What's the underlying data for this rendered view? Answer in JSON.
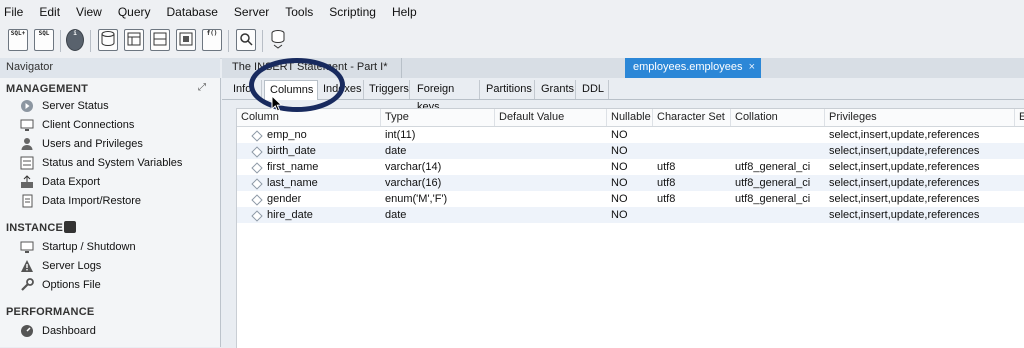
{
  "menu": [
    "File",
    "Edit",
    "View",
    "Query",
    "Database",
    "Server",
    "Tools",
    "Scripting",
    "Help"
  ],
  "toolbar_icons": [
    {
      "name": "new-sql-tab-icon",
      "label": "SQL+"
    },
    {
      "name": "open-sql-script-icon",
      "label": "SQL"
    },
    {
      "name": "inspect-object-icon",
      "label": "i"
    },
    {
      "name": "create-schema-icon",
      "label": ""
    },
    {
      "name": "create-table-icon",
      "label": ""
    },
    {
      "name": "create-view-icon",
      "label": ""
    },
    {
      "name": "create-procedure-icon",
      "label": ""
    },
    {
      "name": "create-function-icon",
      "label": "f()"
    },
    {
      "name": "search-table-data-icon",
      "label": ""
    },
    {
      "name": "reconnect-icon",
      "label": ""
    }
  ],
  "navigator": {
    "title": "Navigator",
    "management": {
      "title": "MANAGEMENT",
      "items": [
        "Server Status",
        "Client Connections",
        "Users and Privileges",
        "Status and System Variables",
        "Data Export",
        "Data Import/Restore"
      ]
    },
    "instance": {
      "title": "INSTANCE",
      "items": [
        "Startup / Shutdown",
        "Server Logs",
        "Options File"
      ]
    },
    "performance": {
      "title": "PERFORMANCE",
      "items": [
        "Dashboard"
      ]
    }
  },
  "editor_tabs": [
    {
      "label": "The INSERT Statement - Part I*"
    },
    {
      "label": "employees.employees",
      "close": "×"
    }
  ],
  "inspector_tabs": [
    "Info",
    "Columns",
    "Indexes",
    "Triggers",
    "Foreign keys",
    "Partitions",
    "Grants",
    "DDL"
  ],
  "columns_table": {
    "headers": [
      "Column",
      "Type",
      "Default Value",
      "Nullable",
      "Character Set",
      "Collation",
      "Privileges",
      "E"
    ],
    "rows": [
      [
        "emp_no",
        "int(11)",
        "",
        "NO",
        "",
        "",
        "select,insert,update,references"
      ],
      [
        "birth_date",
        "date",
        "",
        "NO",
        "",
        "",
        "select,insert,update,references"
      ],
      [
        "first_name",
        "varchar(14)",
        "",
        "NO",
        "utf8",
        "utf8_general_ci",
        "select,insert,update,references"
      ],
      [
        "last_name",
        "varchar(16)",
        "",
        "NO",
        "utf8",
        "utf8_general_ci",
        "select,insert,update,references"
      ],
      [
        "gender",
        "enum('M','F')",
        "",
        "NO",
        "utf8",
        "utf8_general_ci",
        "select,insert,update,references"
      ],
      [
        "hire_date",
        "date",
        "",
        "NO",
        "",
        "",
        "select,insert,update,references"
      ]
    ]
  },
  "colors": {
    "accent": "#2b87d7",
    "ring": "#182a5e",
    "alt_row": "#eef3fa"
  }
}
